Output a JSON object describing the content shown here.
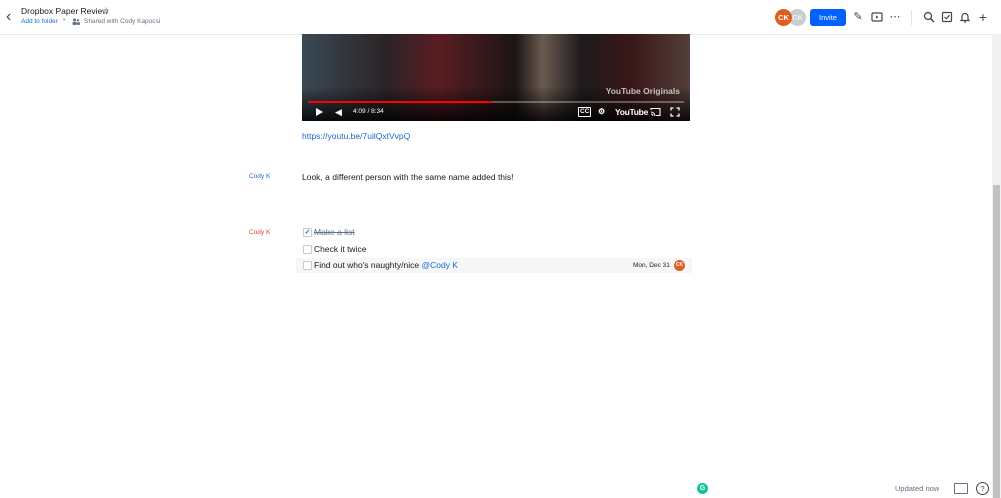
{
  "header": {
    "doc_title": "Dropbox Paper Review",
    "add_to_folder": "Add to folder",
    "separator": "•",
    "shared_with": "Shared with Cody Kapocsi",
    "avatars": [
      "CK",
      "CK"
    ],
    "invite_label": "Invite",
    "icons": [
      "pencil-icon",
      "present-icon",
      "more-icon",
      "search-icon",
      "checklist-icon",
      "bell-icon",
      "plus-icon"
    ]
  },
  "video": {
    "time": "4:09 / 8:34",
    "brand": "YouTube Originals",
    "logo": "YouTube",
    "progress": 0.49
  },
  "content": {
    "link": "https://youtu.be/7uilQxtVvpQ",
    "blocks": [
      {
        "author": "Cody K",
        "author_color": "#1b6ac9",
        "text": "Look, a different person with the same name added this!"
      }
    ],
    "task_author": "Cody K",
    "task_author_color": "#d9412e",
    "tasks": [
      {
        "text": "Make a list",
        "done": true
      },
      {
        "text": "Check it twice",
        "done": false
      },
      {
        "text": "Find out who's naughty/nice ",
        "mention": "@Cody K",
        "due": "Mon, Dec 31",
        "assignee": "CK",
        "done": false
      }
    ]
  },
  "footer": {
    "status": "Updated now",
    "help": "?"
  },
  "colors": {
    "accent": "#0061fe",
    "link": "#1b6ac9",
    "avatar": "#e05d21",
    "grammarly": "#15c39a"
  }
}
